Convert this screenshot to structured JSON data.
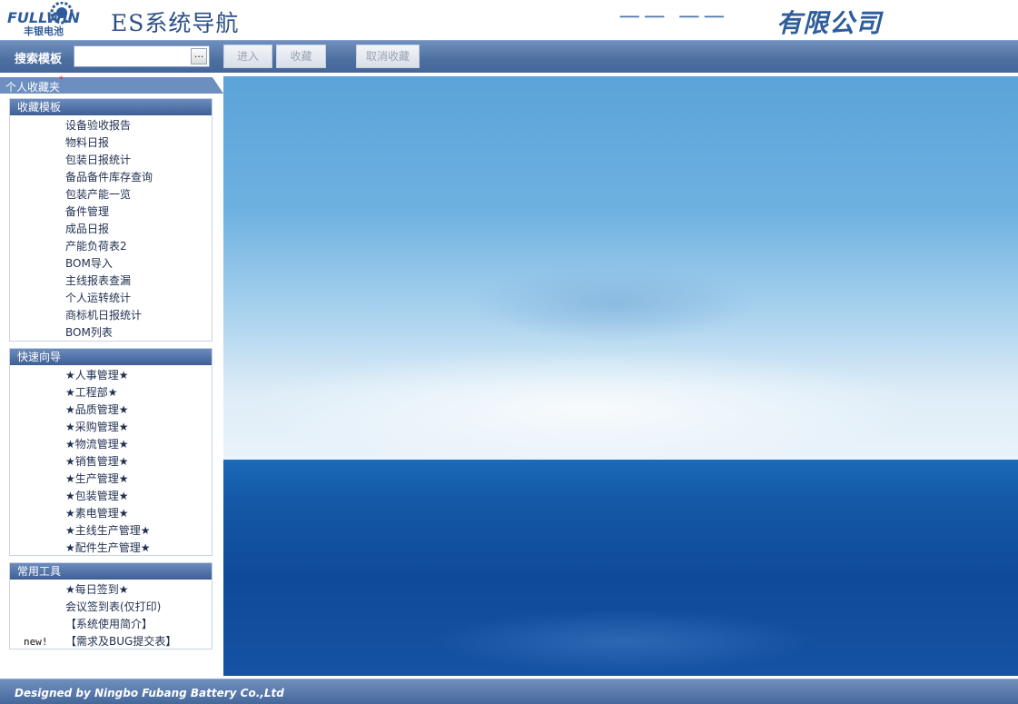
{
  "header": {
    "logo_text": "FULLWIN",
    "logo_subtext": "丰银电池",
    "app_title": "ES系统导航",
    "company_name_visible": "有限公司"
  },
  "toolbar": {
    "search_label": "搜索模板",
    "search_value": "",
    "browse_glyph": "...",
    "enter_label": "进入",
    "favorite_label": "收藏",
    "unfavorite_label": "取消收藏"
  },
  "sidebar": {
    "header_label": "个人收藏夹",
    "header_mark": "*",
    "panels": [
      {
        "title": "收藏模板",
        "items": [
          "设备验收报告",
          "物料日报",
          "包装日报统计",
          "备品备件库存查询",
          "包装产能一览",
          "备件管理",
          "成品日报",
          "产能负荷表2",
          "BOM导入",
          "主线报表查漏",
          "个人运转统计",
          "商标机日报统计",
          "BOM列表"
        ]
      },
      {
        "title": "快速向导",
        "items": [
          "★人事管理★",
          "★工程部★",
          "★品质管理★",
          "★采购管理★",
          "★物流管理★",
          "★销售管理★",
          "★生产管理★",
          "★包装管理★",
          "★素电管理★",
          "★主线生产管理★",
          "★配件生产管理★"
        ]
      },
      {
        "title": "常用工具",
        "items": [
          "★每日签到★",
          "会议签到表(仅打印)",
          "【系统使用简介】",
          "【需求及BUG提交表】"
        ],
        "new_tag": "new!"
      }
    ]
  },
  "footer": {
    "text": "Designed by Ningbo Fubang Battery  Co.,Ltd"
  },
  "colors": {
    "bar_blue": "#4d6fa0",
    "title_blue": "#2c4f86",
    "sky_top": "#5ba3d9",
    "sea": "#1459a7"
  }
}
